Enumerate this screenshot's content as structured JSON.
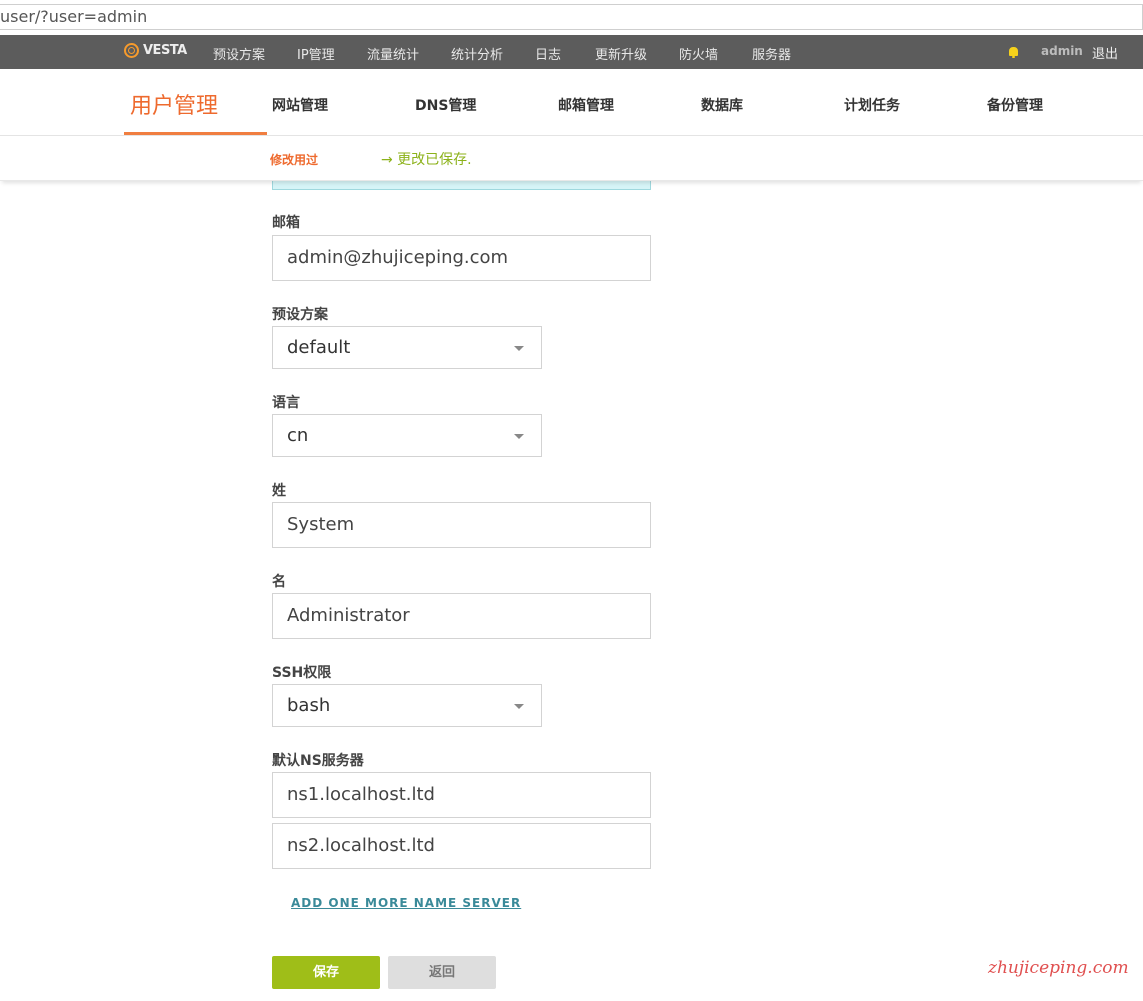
{
  "browser": {
    "url": "user/?user=admin"
  },
  "topbar": {
    "logo_text": "VESTA",
    "nav": [
      "预设方案",
      "IP管理",
      "流量统计",
      "统计分析",
      "日志",
      "更新升级",
      "防火墙",
      "服务器"
    ],
    "user": "admin",
    "logout": "退出"
  },
  "tabs": {
    "active": "用户管理",
    "items": [
      "网站管理",
      "DNS管理",
      "邮箱管理",
      "数据库",
      "计划任务",
      "备份管理"
    ]
  },
  "subbar": {
    "title": "修改用过",
    "status": "→ 更改已保存."
  },
  "form": {
    "email": {
      "label": "邮箱",
      "value": "admin@zhujiceping.com"
    },
    "package": {
      "label": "预设方案",
      "value": "default"
    },
    "language": {
      "label": "语言",
      "value": "cn"
    },
    "last_name": {
      "label": "姓",
      "value": "System"
    },
    "first_name": {
      "label": "名",
      "value": "Administrator"
    },
    "ssh": {
      "label": "SSH权限",
      "value": "bash"
    },
    "ns": {
      "label": "默认NS服务器",
      "ns1": "ns1.localhost.ltd",
      "ns2": "ns2.localhost.ltd"
    },
    "add_ns": "ADD ONE MORE NAME SERVER",
    "save": "保存",
    "back": "返回"
  },
  "watermark": "zhujiceping.com",
  "colors": {
    "accent": "#ee6a2e",
    "success": "#8cb21a",
    "save": "#9fbe18",
    "topbar": "#5c5c5c"
  }
}
